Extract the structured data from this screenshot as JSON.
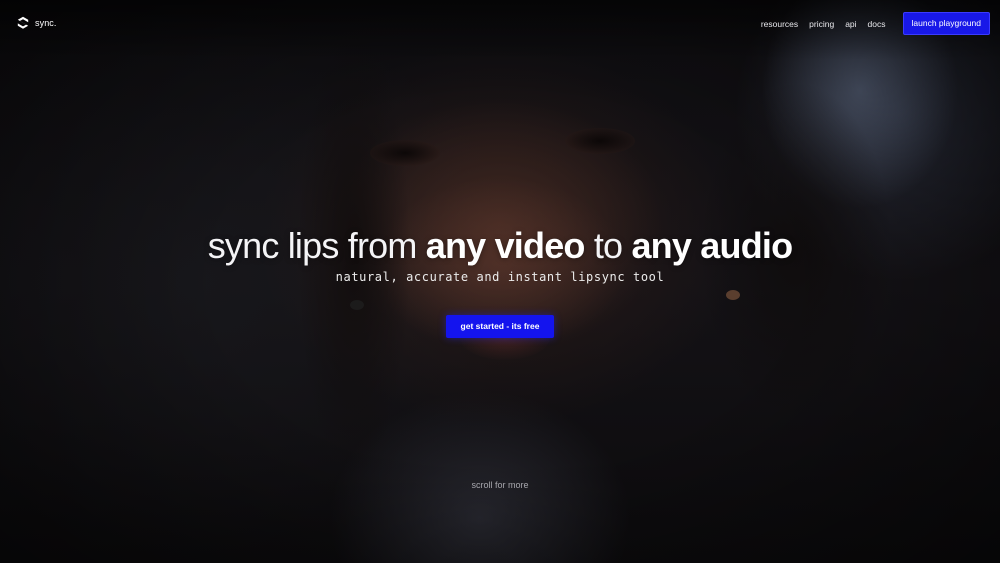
{
  "header": {
    "logo_text": "sync.",
    "logo_icon": "sync-logo-icon",
    "nav": [
      {
        "label": "resources"
      },
      {
        "label": "pricing"
      },
      {
        "label": "api"
      },
      {
        "label": "docs"
      }
    ],
    "launch_label": "launch playground"
  },
  "hero": {
    "headline_part1": "sync lips from ",
    "headline_part2": "any video",
    "headline_part3": " to ",
    "headline_part4": "any audio",
    "subtitle": "natural, accurate and instant lipsync tool",
    "cta_label": "get started - its free"
  },
  "footer": {
    "scroll_hint": "scroll for more"
  },
  "colors": {
    "accent": "#1414ee",
    "background": "#0b0a0c",
    "text": "#ffffff"
  }
}
